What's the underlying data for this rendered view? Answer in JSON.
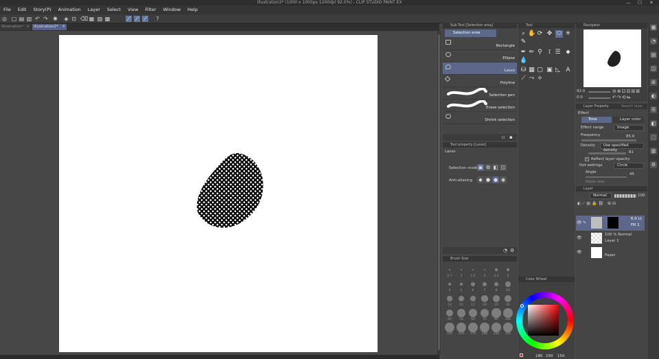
{
  "window": {
    "title": "Illustration2* (1000 x 1000px 1200dpi 92.0%) - CLIP STUDIO PAINT EX",
    "minimize": "—",
    "maximize": "☐",
    "close": "✕"
  },
  "menu": [
    "File",
    "Edit",
    "Story(P)",
    "Animation",
    "Layer",
    "Select",
    "View",
    "Filter",
    "Window",
    "Help"
  ],
  "tabs": [
    {
      "label": "Illustration*",
      "close": "✕"
    },
    {
      "label": "Illustration2*",
      "close": "✕"
    }
  ],
  "sub_tool": {
    "title": "Sub Tool [Selection area]",
    "group_label": "Selection area",
    "items": [
      {
        "label": "Rectangle",
        "icon": "rectangle-icon"
      },
      {
        "label": "Ellipse",
        "icon": "ellipse-icon"
      },
      {
        "label": "Lasso",
        "icon": "lasso-icon",
        "selected": true
      },
      {
        "label": "Polyline",
        "icon": "polyline-icon"
      },
      {
        "label": "Selection pen",
        "icon": "selection-pen-icon"
      },
      {
        "label": "Erase selection",
        "icon": "erase-selection-icon"
      },
      {
        "label": "Shrink selection",
        "icon": "shrink-selection-icon"
      }
    ]
  },
  "tool_panel": {
    "title": "Tool"
  },
  "tool_property": {
    "title": "Tool property [Lasso]",
    "tool_name": "Lasso",
    "selection_mode_label": "Selection mode",
    "anti_aliasing_label": "Anti-aliasing"
  },
  "brush_size": {
    "title": "Brush Size",
    "sizes": [
      "0.7",
      "1",
      "1.5",
      "2",
      "2.5",
      "3",
      "4",
      "5",
      "6",
      "7",
      "8",
      "10",
      "12",
      "15",
      "17",
      "20",
      "25",
      "30",
      "40",
      "50",
      "60",
      "70",
      "80",
      "100",
      "120",
      "150",
      "170",
      "200",
      "250",
      "300"
    ]
  },
  "navigator": {
    "title": "Navigator",
    "zoom": "92.0",
    "angle": "0.0"
  },
  "layer_property": {
    "title": "Layer Property",
    "search_placeholder": "Search layer",
    "effect_label": "Effect",
    "tone_btn": "Tone",
    "layer_color_btn": "Layer color",
    "effect_range_label": "Effect range",
    "effect_range_value": "Image",
    "frequency_label": "Frequency",
    "frequency_value": "85.0",
    "density_label": "Density",
    "density_value": "Use specified density",
    "density_num": "81",
    "reflect_opacity_label": "Reflect layer opacity",
    "dot_settings_label": "Dot settings",
    "dot_shape": "Circle",
    "angle_label": "Angle",
    "angle_value": "45",
    "noise_label": "Noise size"
  },
  "layer_panel": {
    "title": "Layer",
    "blend_mode": "Normal",
    "opacity": "100",
    "layers": [
      {
        "line1": "6.0 Lt",
        "line2": "Fill 1",
        "selected": true
      },
      {
        "line1": "100 % Normal",
        "line2": "Layer 1",
        "selected": false
      },
      {
        "line1": "",
        "line2": "Paper",
        "selected": false
      }
    ]
  },
  "color_wheel": {
    "title": "Color Wheel",
    "h": "180",
    "s": "150",
    "v": "150"
  },
  "colors": {
    "accent": "#5c678a",
    "panel_bg": "#454545",
    "dark_bg": "#2d2d2d",
    "canvas_bg": "#474747"
  }
}
